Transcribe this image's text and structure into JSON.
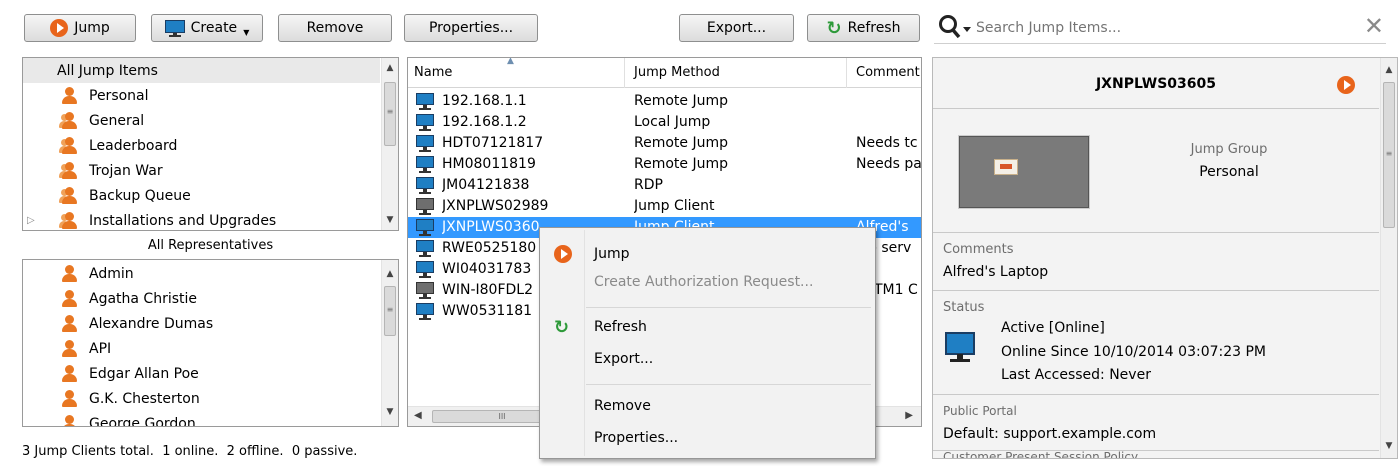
{
  "toolbar": {
    "jump": "Jump",
    "create": "Create",
    "remove": "Remove",
    "properties": "Properties...",
    "export": "Export...",
    "refresh": "Refresh"
  },
  "search": {
    "placeholder": "Search Jump Items..."
  },
  "groups_tree": {
    "items": [
      "All Jump Items",
      "Personal",
      "General",
      "Leaderboard",
      "Trojan War",
      "Backup Queue",
      "Installations and Upgrades"
    ]
  },
  "reps": {
    "header": "All Representatives",
    "items": [
      "Admin",
      "Agatha Christie",
      "Alexandre Dumas",
      "API",
      "Edgar Allan Poe",
      "G.K. Chesterton",
      "George Gordon"
    ]
  },
  "status_text": "3 Jump Clients total.  1 online.  2 offline.  0 passive.",
  "jump_list": {
    "columns": [
      "Name",
      "Jump Method",
      "Comment"
    ],
    "rows": [
      {
        "name": "192.168.1.1",
        "method": "Remote Jump",
        "comment": ""
      },
      {
        "name": "192.168.1.2",
        "method": "Local Jump",
        "comment": ""
      },
      {
        "name": "HDT07121817",
        "method": "Remote Jump",
        "comment": "Needs tc"
      },
      {
        "name": "HM08011819",
        "method": "Remote Jump",
        "comment": "Needs pa"
      },
      {
        "name": "JM04121838",
        "method": "RDP",
        "comment": ""
      },
      {
        "name": "JXNPLWS02989",
        "method": "Jump Client",
        "comment": ""
      },
      {
        "name": "JXNPLWS0360",
        "method": "Jump Client",
        "comment": "Alfred's"
      },
      {
        "name": "RWE0525180",
        "method": "",
        "comment": "b serv"
      },
      {
        "name": "WI04031783",
        "method": "",
        "comment": ""
      },
      {
        "name": "WIN-I80FDL2",
        "method": "",
        "comment": "TM1 C"
      },
      {
        "name": "WW0531181",
        "method": "",
        "comment": ""
      }
    ],
    "hscroll_glyph": "III"
  },
  "context_menu": {
    "jump": "Jump",
    "create_auth": "Create Authorization Request...",
    "refresh": "Refresh",
    "export": "Export...",
    "remove": "Remove",
    "properties": "Properties..."
  },
  "details": {
    "title": "JXNPLWS03605",
    "jump_group_label": "Jump Group",
    "jump_group_value": "Personal",
    "comments_label": "Comments",
    "comments_value": "Alfred's Laptop",
    "status_label": "Status",
    "status_line1": "Active [Online]",
    "status_line2": "Online Since 10/10/2014 03:07:23 PM",
    "status_line3": "Last Accessed: Never",
    "portal_label": "Public Portal",
    "portal_value": "Default: support.example.com",
    "policy_label": "Customer Present Session Policy"
  },
  "colors": {
    "accent_orange": "#e8641b",
    "selection_blue": "#3399ff",
    "refresh_green": "#2e9a3a"
  }
}
